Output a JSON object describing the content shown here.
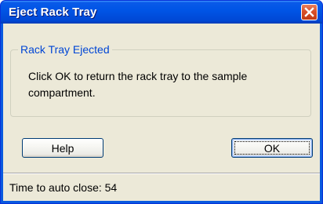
{
  "window": {
    "title": "Eject Rack Tray",
    "close_icon": "close-icon"
  },
  "group": {
    "legend": "Rack Tray Ejected",
    "message": "Click OK to return the rack tray to the sample compartment."
  },
  "buttons": {
    "help_label": "Help",
    "ok_label": "OK"
  },
  "status": {
    "text": "Time to auto close: 54"
  },
  "colors": {
    "titlebar": "#0055e6",
    "client_background": "#ece9d8",
    "legend_text": "#0046d5",
    "close_button": "#d9502a"
  }
}
